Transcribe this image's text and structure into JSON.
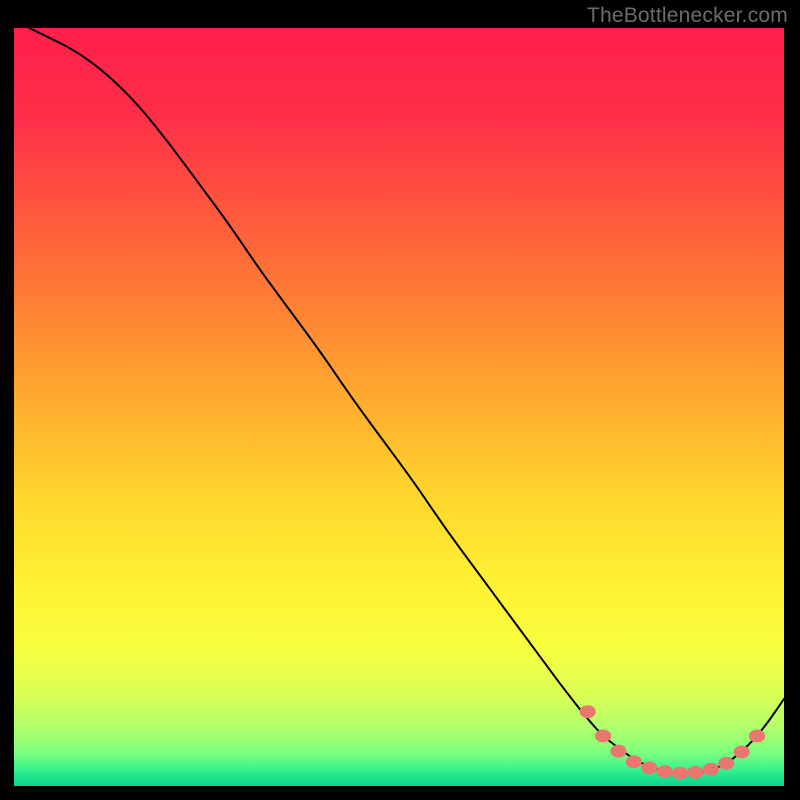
{
  "attribution": "TheBottlenecker.com",
  "chart_data": {
    "type": "line",
    "title": "",
    "xlabel": "",
    "ylabel": "",
    "xlim": [
      0,
      100
    ],
    "ylim": [
      0,
      100
    ],
    "series": [
      {
        "name": "curve",
        "x": [
          0,
          4,
          8,
          12,
          16,
          20,
          24,
          28,
          32,
          36,
          40,
          44,
          48,
          52,
          56,
          60,
          64,
          68,
          72,
          76,
          78.5,
          81,
          83.5,
          86,
          88.5,
          91,
          93.5,
          96,
          98,
          100
        ],
        "y": [
          101,
          99,
          97,
          94,
          90,
          85,
          79.5,
          74,
          68,
          62.5,
          57,
          51,
          45.5,
          40,
          34,
          28.5,
          23,
          17.5,
          12,
          7,
          5,
          3.2,
          2.2,
          1.7,
          1.6,
          2.2,
          3.6,
          6,
          8.5,
          11.5
        ]
      }
    ],
    "points": [
      {
        "x": 74.5,
        "y": 9.8
      },
      {
        "x": 76.5,
        "y": 6.6
      },
      {
        "x": 78.5,
        "y": 4.6
      },
      {
        "x": 80.5,
        "y": 3.2
      },
      {
        "x": 82.5,
        "y": 2.4
      },
      {
        "x": 84.5,
        "y": 1.9
      },
      {
        "x": 86.5,
        "y": 1.7
      },
      {
        "x": 88.5,
        "y": 1.8
      },
      {
        "x": 90.5,
        "y": 2.2
      },
      {
        "x": 92.5,
        "y": 3.0
      },
      {
        "x": 94.5,
        "y": 4.5
      },
      {
        "x": 96.5,
        "y": 6.6
      }
    ],
    "gradient_stops": [
      {
        "offset": 0.0,
        "color": "#ff1e4b"
      },
      {
        "offset": 0.12,
        "color": "#ff2f48"
      },
      {
        "offset": 0.25,
        "color": "#ff5a3c"
      },
      {
        "offset": 0.38,
        "color": "#ff8533"
      },
      {
        "offset": 0.5,
        "color": "#ffae2e"
      },
      {
        "offset": 0.62,
        "color": "#ffd62d"
      },
      {
        "offset": 0.74,
        "color": "#fff334"
      },
      {
        "offset": 0.82,
        "color": "#f6ff3f"
      },
      {
        "offset": 0.88,
        "color": "#d9ff55"
      },
      {
        "offset": 0.92,
        "color": "#b4ff6a"
      },
      {
        "offset": 0.955,
        "color": "#7fff7d"
      },
      {
        "offset": 0.975,
        "color": "#42f58b"
      },
      {
        "offset": 0.99,
        "color": "#18e28f"
      },
      {
        "offset": 1.0,
        "color": "#0fd38d"
      }
    ],
    "point_color": "#e9766f",
    "line_color": "#000000"
  }
}
